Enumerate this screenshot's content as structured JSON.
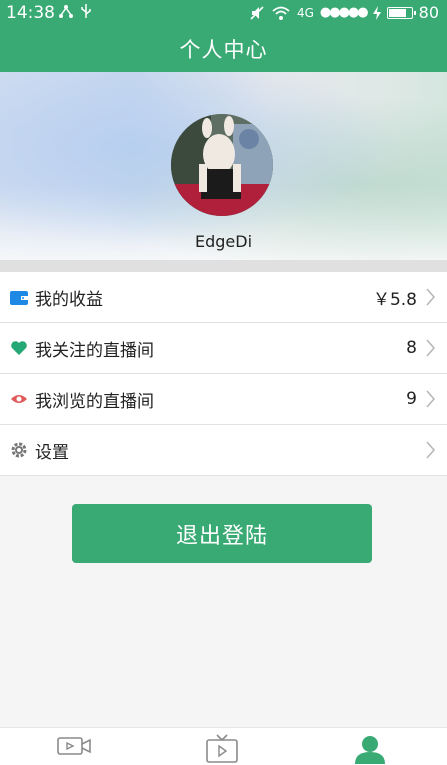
{
  "status_bar": {
    "time": "14:38",
    "network": "4G",
    "battery": "80",
    "battery_level": 0.8
  },
  "header": {
    "title": "个人中心"
  },
  "profile": {
    "username": "EdgeDi"
  },
  "menu": [
    {
      "icon": "wallet-icon",
      "label": "我的收益",
      "value": "￥5.8",
      "color": "#1e88e5"
    },
    {
      "icon": "heart-icon",
      "label": "我关注的直播间",
      "value": "8",
      "color": "#26a874"
    },
    {
      "icon": "eye-icon",
      "label": "我浏览的直播间",
      "value": "9",
      "color": "#e05a5a"
    },
    {
      "icon": "gear-icon",
      "label": "设置",
      "value": "",
      "color": "#777777"
    }
  ],
  "logout": {
    "label": "退出登陆"
  },
  "tabs": [
    {
      "icon": "video-camera-icon"
    },
    {
      "icon": "tv-play-icon"
    },
    {
      "icon": "user-icon",
      "active": true
    }
  ],
  "colors": {
    "accent": "#3aaa75"
  }
}
